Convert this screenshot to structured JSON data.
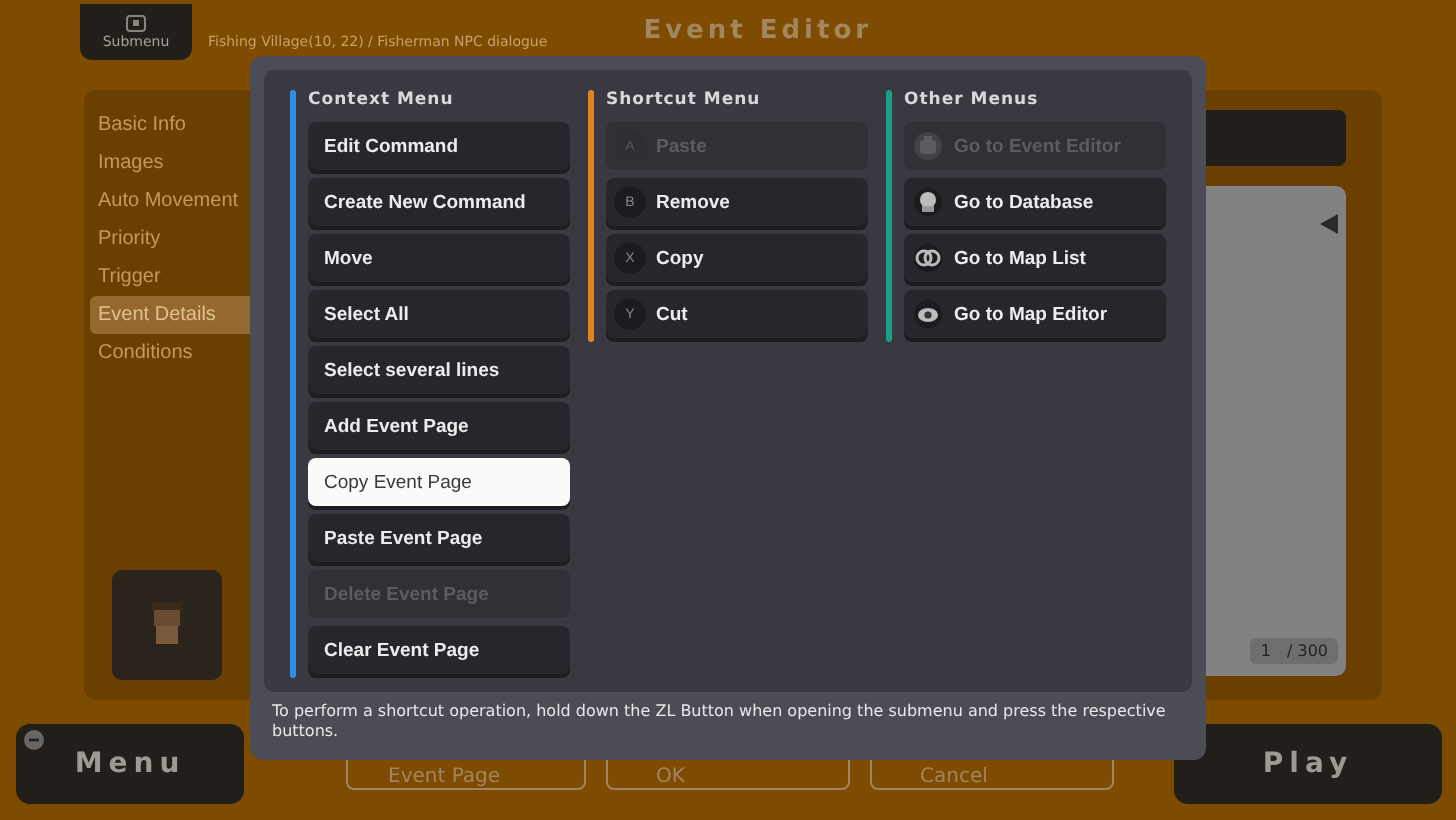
{
  "header": {
    "submenu_button": "Submenu",
    "breadcrumb": "Fishing Village(10, 22) / Fisherman NPC dialogue",
    "title": "Event Editor"
  },
  "sidebar": {
    "items": [
      {
        "label": "Basic Info",
        "selected": false
      },
      {
        "label": "Images",
        "selected": false
      },
      {
        "label": "Auto Movement",
        "selected": false
      },
      {
        "label": "Priority",
        "selected": false
      },
      {
        "label": "Trigger",
        "selected": false
      },
      {
        "label": "Event Details",
        "selected": true
      },
      {
        "label": "Conditions",
        "selected": false
      }
    ]
  },
  "page_counter": {
    "current": "1",
    "total": "/ 300"
  },
  "bottom_bar": {
    "menu_button": "Menu",
    "page_dropdown": "Event Page",
    "ok_button": "OK",
    "cancel_button": "Cancel",
    "play_button": "Play"
  },
  "dialog": {
    "columns": [
      {
        "title": "Context Menu",
        "color": "#2f8fe0",
        "items": [
          {
            "kind": "plain",
            "label": "Edit Command",
            "selected": false,
            "disabled": false
          },
          {
            "kind": "plain",
            "label": "Create New Command",
            "selected": false,
            "disabled": false
          },
          {
            "kind": "plain",
            "label": "Move",
            "selected": false,
            "disabled": false
          },
          {
            "kind": "plain",
            "label": "Select All",
            "selected": false,
            "disabled": false
          },
          {
            "kind": "plain",
            "label": "Select several lines",
            "selected": false,
            "disabled": false
          },
          {
            "kind": "plain",
            "label": "Add Event Page",
            "selected": false,
            "disabled": false
          },
          {
            "kind": "plain",
            "label": "Copy Event Page",
            "selected": true,
            "disabled": false
          },
          {
            "kind": "plain",
            "label": "Paste Event Page",
            "selected": false,
            "disabled": false
          },
          {
            "kind": "plain",
            "label": "Delete Event Page",
            "selected": false,
            "disabled": true
          },
          {
            "kind": "plain",
            "label": "Clear Event Page",
            "selected": false,
            "disabled": false
          }
        ]
      },
      {
        "title": "Shortcut Menu",
        "color": "#e8821e",
        "items": [
          {
            "kind": "key",
            "key": "A",
            "label": "Paste",
            "selected": false,
            "disabled": true
          },
          {
            "kind": "key",
            "key": "B",
            "label": "Remove",
            "selected": false,
            "disabled": false
          },
          {
            "kind": "key",
            "key": "X",
            "label": "Copy",
            "selected": false,
            "disabled": false
          },
          {
            "kind": "key",
            "key": "Y",
            "label": "Cut",
            "selected": false,
            "disabled": false
          }
        ]
      },
      {
        "title": "Other Menus",
        "color": "#16a085",
        "items": [
          {
            "kind": "icon",
            "label": "Go to Event Editor",
            "selected": false,
            "disabled": true
          },
          {
            "kind": "icon",
            "label": "Go to Database",
            "selected": false,
            "disabled": false
          },
          {
            "kind": "icon",
            "label": "Go to Map List",
            "selected": false,
            "disabled": false
          },
          {
            "kind": "icon",
            "label": "Go to Map Editor",
            "selected": false,
            "disabled": false
          }
        ]
      }
    ],
    "hint": "To perform a shortcut operation, hold down the ZL Button when opening the submenu and press the respective buttons."
  }
}
